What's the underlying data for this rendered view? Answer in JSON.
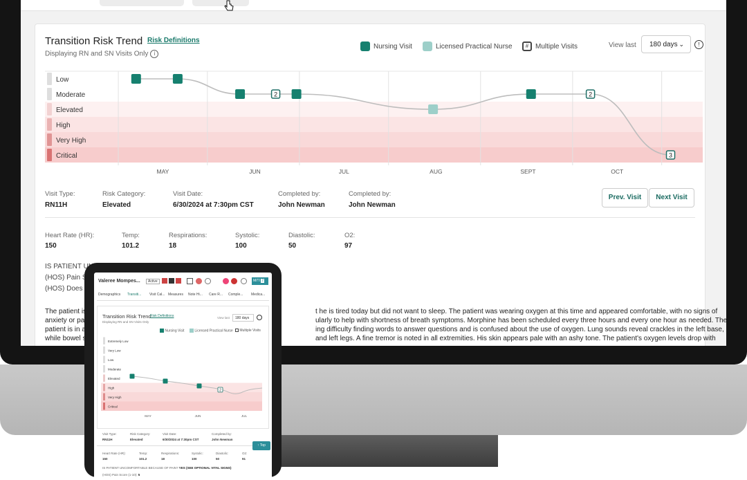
{
  "header": {
    "title": "Transition Risk Trend",
    "risk_definitions": "Risk Definitions",
    "subtitle": "Displaying RN and SN Visits Only"
  },
  "legend": [
    {
      "label": "Nursing Visit",
      "color": "#16806f"
    },
    {
      "label": "Licensed Practical Nurse",
      "color": "#9dcfc9"
    },
    {
      "label": "Multiple Visits",
      "color": "#444444"
    }
  ],
  "view_last": {
    "label": "View last",
    "selected": "180 days"
  },
  "chart_data": {
    "type": "line",
    "y_categories": [
      "Low",
      "Moderate",
      "Elevated",
      "High",
      "Very High",
      "Critical"
    ],
    "x_ticks": [
      "MAY",
      "JUN",
      "JUL",
      "AUG",
      "SEPT",
      "OCT"
    ],
    "points": [
      {
        "x": "2024-04-28",
        "y": "Low",
        "kind": "Nursing Visit"
      },
      {
        "x": "2024-05-12",
        "y": "Low",
        "kind": "Nursing Visit"
      },
      {
        "x": "2024-06-02",
        "y": "Moderate",
        "kind": "Nursing Visit"
      },
      {
        "x": "2024-06-14",
        "y": "Moderate",
        "kind": "Multiple Visits",
        "count": "2"
      },
      {
        "x": "2024-06-21",
        "y": "Moderate",
        "kind": "Nursing Visit"
      },
      {
        "x": "2024-08-06",
        "y": "Elevated",
        "kind": "Licensed Practical Nurse"
      },
      {
        "x": "2024-09-08",
        "y": "Moderate",
        "kind": "Nursing Visit"
      },
      {
        "x": "2024-09-28",
        "y": "Moderate",
        "kind": "Multiple Visits",
        "count": "2"
      },
      {
        "x": "2024-10-25",
        "y": "Critical",
        "kind": "Multiple Visits",
        "count": "3"
      }
    ]
  },
  "visit": {
    "fields": [
      {
        "label": "Visit Type:",
        "value": "RN11H"
      },
      {
        "label": "Risk Category:",
        "value": "Elevated"
      },
      {
        "label": "Visit Date:",
        "value": "6/30/2024 at 7:30pm CST"
      },
      {
        "label": "Completed by:",
        "value": "John Newman"
      },
      {
        "label": "Completed by:",
        "value": "John Newman"
      }
    ],
    "prev_label": "Prev. Visit",
    "next_label": "Next Visit"
  },
  "vitals": [
    {
      "label": "Heart Rate (HR):",
      "value": "150"
    },
    {
      "label": "Temp:",
      "value": "101.2"
    },
    {
      "label": "Respirations:",
      "value": "18"
    },
    {
      "label": "Systolic:",
      "value": "100"
    },
    {
      "label": "Diastolic:",
      "value": "50"
    },
    {
      "label": "O2:",
      "value": "97"
    }
  ],
  "questions": [
    "IS PATIENT UN",
    "(HOS) Pain S",
    "(HOS) Does D"
  ],
  "narrative": [
    "The patient is",
    "t he is tired today but did not want to sleep. The patient was wearing oxygen at this time and appeared comfortable, with no signs of",
    "anxiety or pa",
    "ularly to help with shortness of breath symptoms. Morphine has been scheduled every three hours and every one hour as needed. The",
    "patient is in a",
    "ing difficulty finding words to answer questions and is confused about the use of oxygen. Lung sounds reveal crackles in the left base,",
    "while bowel s",
    "and left legs. A fine tremor is noted in all extremities. His skin appears pale with an ashy tone. The patient's oxygen levels drop with"
  ],
  "tablet": {
    "patient": "Valeree Mompes...",
    "status": "Active",
    "badge": "M/TI",
    "badge_num": "2",
    "tabs": [
      "Demographics",
      "Transiti...",
      "Visit Cal...",
      "Measures",
      "Note Hi...",
      "Care R...",
      "Comple...",
      "Medica..."
    ],
    "title": "Transition Risk Trend",
    "risk_definitions": "Risk Definitions",
    "subtitle": "Displaying RN and SN Visits Only",
    "view_last": "View last",
    "selected": "180 days",
    "legend": [
      "Nursing Visit",
      "Licensed Practical Nurse",
      "Multiple Visits"
    ],
    "levels": [
      "Extremely Low",
      "Very Low",
      "Low",
      "Moderate",
      "Elevated",
      "High",
      "Very High",
      "Critical"
    ],
    "x_ticks": [
      "MAY",
      "JUN",
      "JUL"
    ],
    "multi_count": "2",
    "fields": [
      {
        "label": "Visit Type:",
        "value": "RN11H"
      },
      {
        "label": "Risk Category:",
        "value": "Elevated"
      },
      {
        "label": "Visit Date:",
        "value": "6/30/2024 at 7:30pm CST"
      },
      {
        "label": "Completed by:",
        "value": "John Newman"
      }
    ],
    "vitals": [
      {
        "label": "Heart Rate (HR):",
        "value": "150"
      },
      {
        "label": "Temp:",
        "value": "101.2"
      },
      {
        "label": "Respirations:",
        "value": "18"
      },
      {
        "label": "Systolic:",
        "value": "100"
      },
      {
        "label": "Diastolic:",
        "value": "50"
      },
      {
        "label": "O2:",
        "value": "91"
      }
    ],
    "top_button": "↑ Top",
    "question": "IS PATIENT UNCOMFORTABLE BECAUSE OF PAIN?",
    "answer": "YES (SEE OPTIONAL VITAL SIGNS)",
    "sub_question": "(HOS) Pain Score (1-10):",
    "sub_answer": "5"
  }
}
